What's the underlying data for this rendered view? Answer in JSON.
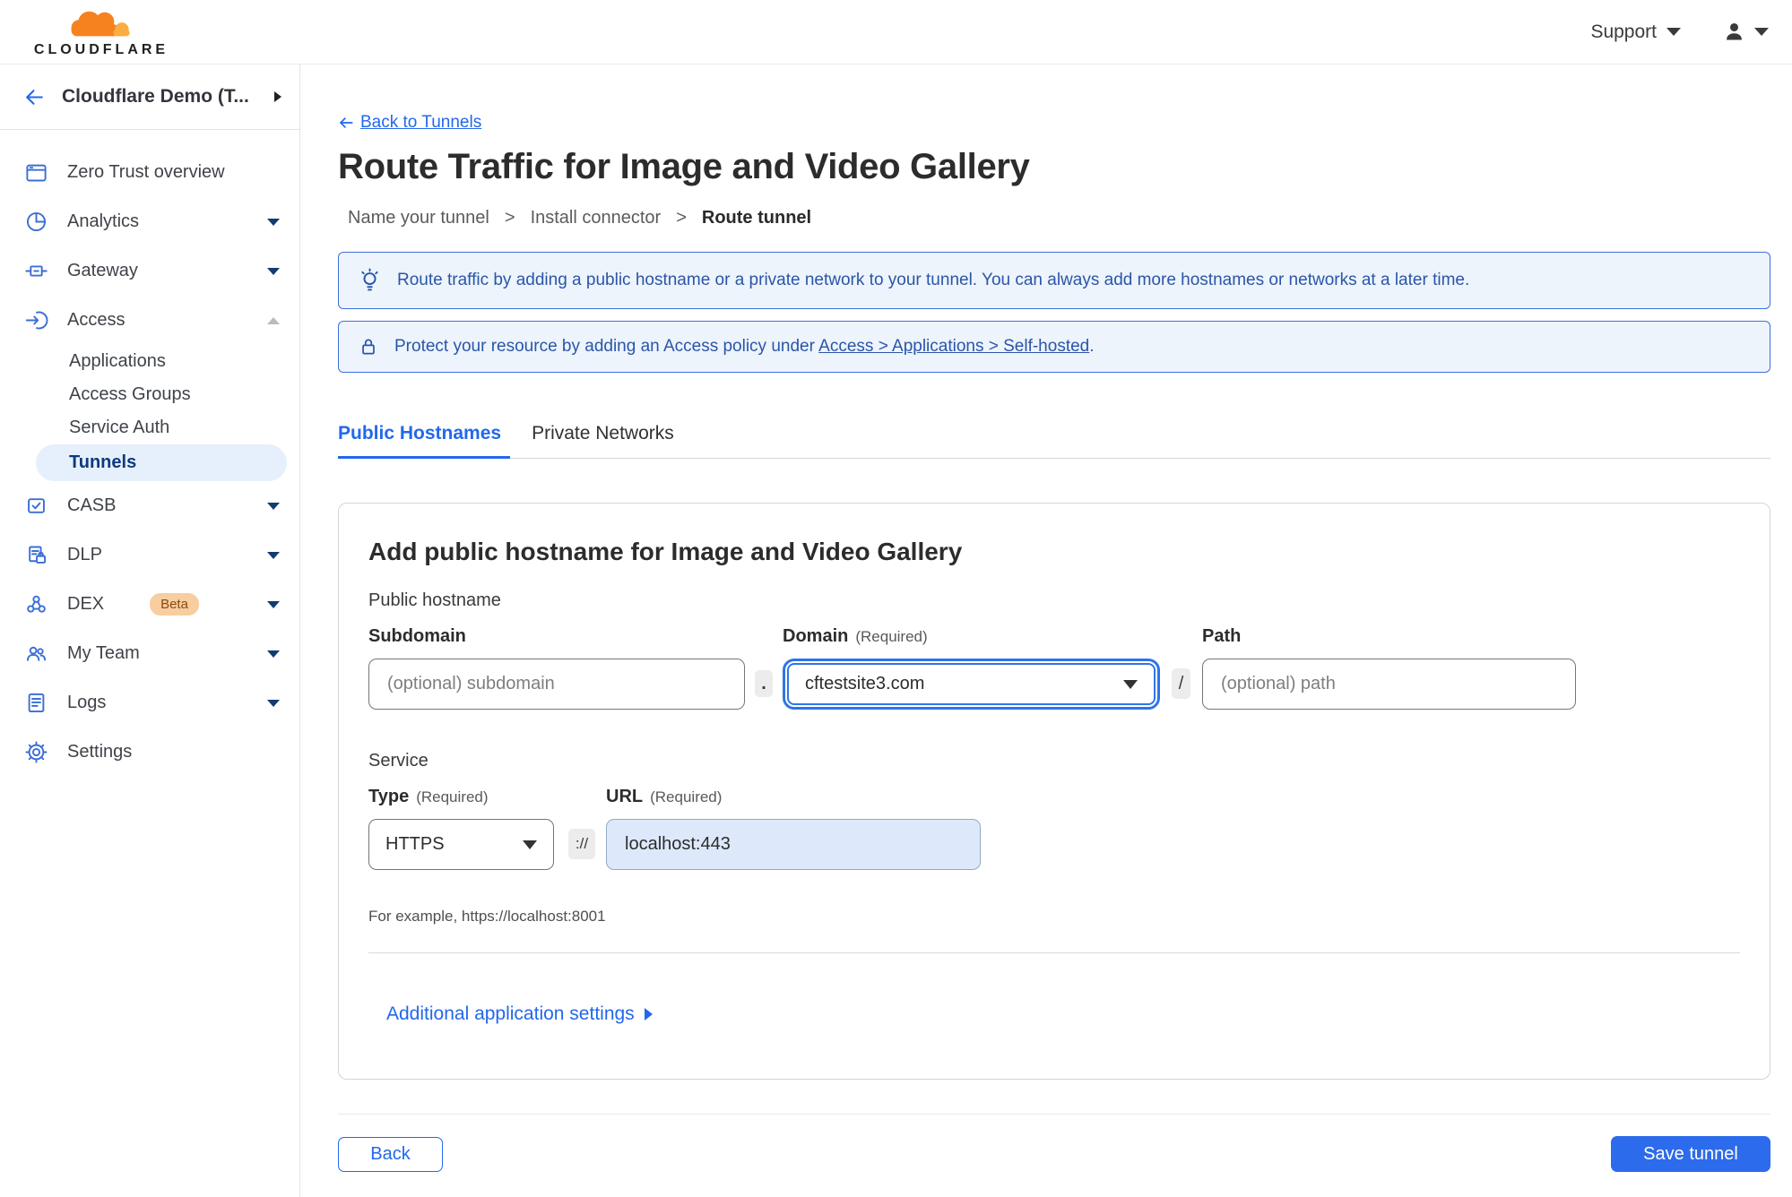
{
  "topbar": {
    "brand": "CLOUDFLARE",
    "support_label": "Support"
  },
  "sidebar": {
    "account_name": "Cloudflare Demo (T...",
    "items": [
      {
        "label": "Zero Trust overview"
      },
      {
        "label": "Analytics"
      },
      {
        "label": "Gateway"
      },
      {
        "label": "Access"
      },
      {
        "label": "Applications"
      },
      {
        "label": "Access Groups"
      },
      {
        "label": "Service Auth"
      },
      {
        "label": "Tunnels"
      },
      {
        "label": "CASB"
      },
      {
        "label": "DLP"
      },
      {
        "label": "DEX",
        "badge": "Beta"
      },
      {
        "label": "My Team"
      },
      {
        "label": "Logs"
      },
      {
        "label": "Settings"
      }
    ]
  },
  "main": {
    "back_link": "Back to Tunnels",
    "title": "Route Traffic for Image and Video Gallery",
    "steps": {
      "step1": "Name your tunnel",
      "step2": "Install connector",
      "step3": "Route tunnel",
      "separator": ">"
    },
    "banners": {
      "info": "Route traffic by adding a public hostname or a private network to your tunnel. You can always add more hostnames or networks at a later time.",
      "protect_prefix": "Protect your resource by adding an Access policy under",
      "protect_link": "Access > Applications > Self-hosted",
      "protect_suffix": "."
    },
    "tabs": {
      "public": "Public Hostnames",
      "private": "Private Networks"
    },
    "form": {
      "heading": "Add public hostname for Image and Video Gallery",
      "public_hostname_label": "Public hostname",
      "subdomain_label": "Subdomain",
      "subdomain_placeholder": "(optional) subdomain",
      "dot_separator": ".",
      "domain_label": "Domain",
      "domain_required": "(Required)",
      "domain_value": "cftestsite3.com",
      "slash_separator": "/",
      "path_label": "Path",
      "path_placeholder": "(optional) path",
      "service_label": "Service",
      "type_label": "Type",
      "type_required": "(Required)",
      "type_value": "HTTPS",
      "scheme_separator": "://",
      "url_label": "URL",
      "url_required": "(Required)",
      "url_value": "localhost:443",
      "example_text": "For example, https://localhost:8001",
      "additional_settings": "Additional application settings"
    },
    "footer": {
      "back_label": "Back",
      "save_label": "Save tunnel"
    }
  },
  "colors": {
    "accent_blue": "#2268ec",
    "sidebar_icon_blue": "#3b6ed6",
    "banner_border": "#3d6edc",
    "banner_bg": "#edf4fc",
    "banner_text": "#2b55a7",
    "selected_nav_bg": "#e6f0fc",
    "selected_nav_text": "#0d3a7d",
    "beta_badge_bg": "#f8cda0",
    "save_button_bg": "#2c6beb"
  }
}
